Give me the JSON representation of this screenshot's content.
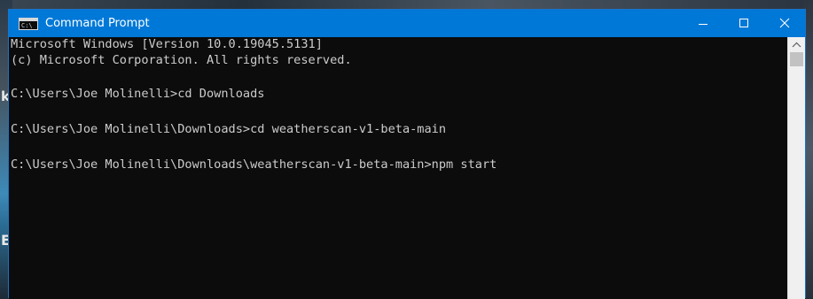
{
  "window": {
    "title": "Command Prompt",
    "icon": "command-prompt-icon",
    "icon_text": "C:\\",
    "accent_color": "#0078d7",
    "controls": [
      "minimize-icon",
      "maximize-icon",
      "close-icon"
    ]
  },
  "console": {
    "lines": [
      "Microsoft Windows [Version 10.0.19045.5131]",
      "(c) Microsoft Corporation. All rights reserved.",
      "",
      "C:\\Users\\Joe Molinelli>cd Downloads",
      "",
      "C:\\Users\\Joe Molinelli\\Downloads>cd weatherscan-v1-beta-main",
      "",
      "C:\\Users\\Joe Molinelli\\Downloads\\weatherscan-v1-beta-main>npm start"
    ],
    "text_color": "#cccccc",
    "background_color": "#0c0c0c"
  },
  "desktop": {
    "left_glyphs": [
      "k",
      "E"
    ]
  }
}
